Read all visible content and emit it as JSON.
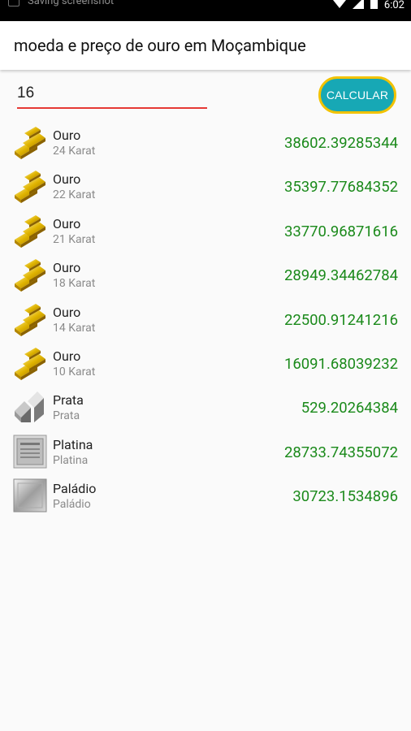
{
  "statusbar": {
    "notification": "Saving screenshot",
    "time": "6:02"
  },
  "appbar": {
    "title": "moeda e preço de ouro em Moçambique"
  },
  "form": {
    "input_value": "16",
    "button_label": "CALCULAR"
  },
  "items": [
    {
      "name": "Ouro",
      "sub": "24 Karat",
      "price": "38602.39285344",
      "icon": "gold-bars-icon"
    },
    {
      "name": "Ouro",
      "sub": "22 Karat",
      "price": "35397.77684352",
      "icon": "gold-bars-icon"
    },
    {
      "name": "Ouro",
      "sub": "21 Karat",
      "price": "33770.96871616",
      "icon": "gold-bars-icon"
    },
    {
      "name": "Ouro",
      "sub": "18 Karat",
      "price": "28949.34462784",
      "icon": "gold-bars-icon"
    },
    {
      "name": "Ouro",
      "sub": "14 Karat",
      "price": "22500.91241216",
      "icon": "gold-bars-icon"
    },
    {
      "name": "Ouro",
      "sub": "10 Karat",
      "price": "16091.68039232",
      "icon": "gold-bars-icon"
    },
    {
      "name": "Prata",
      "sub": "Prata",
      "price": "529.20264384",
      "icon": "silver-bars-icon"
    },
    {
      "name": "Platina",
      "sub": "Platina",
      "price": "28733.74355072",
      "icon": "platinum-bar-icon"
    },
    {
      "name": "Paládio",
      "sub": "Paládio",
      "price": "30723.1534896",
      "icon": "palladium-bar-icon"
    }
  ]
}
